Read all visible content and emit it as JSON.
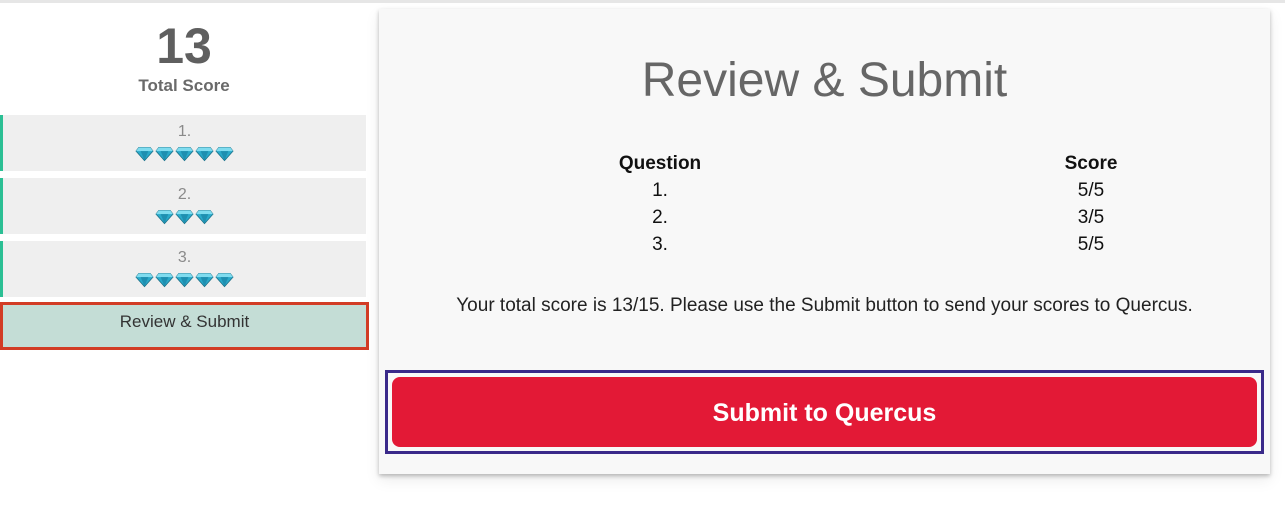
{
  "sidebar": {
    "total_score_value": "13",
    "total_score_label": "Total Score",
    "questions": [
      {
        "number": "1.",
        "gems": 5
      },
      {
        "number": "2.",
        "gems": 3
      },
      {
        "number": "3.",
        "gems": 5
      }
    ],
    "review_label": "Review & Submit"
  },
  "main": {
    "title": "Review & Submit",
    "table": {
      "headers": [
        "Question",
        "Score"
      ],
      "rows": [
        {
          "question": "1.",
          "score": "5/5"
        },
        {
          "question": "2.",
          "score": "3/5"
        },
        {
          "question": "3.",
          "score": "5/5"
        }
      ]
    },
    "summary": "Your total score is 13/15. Please use the Submit button to send your scores to Quercus.",
    "submit_label": "Submit to Quercus"
  },
  "colors": {
    "accent_green": "#2bbf94",
    "review_bg": "#c4ddd6",
    "review_border": "#d23c25",
    "submit_bg": "#e31936",
    "submit_frame": "#3a2a8a",
    "gem": "#29a9c9"
  },
  "icons": {
    "gem": "diamond-gem-icon"
  }
}
